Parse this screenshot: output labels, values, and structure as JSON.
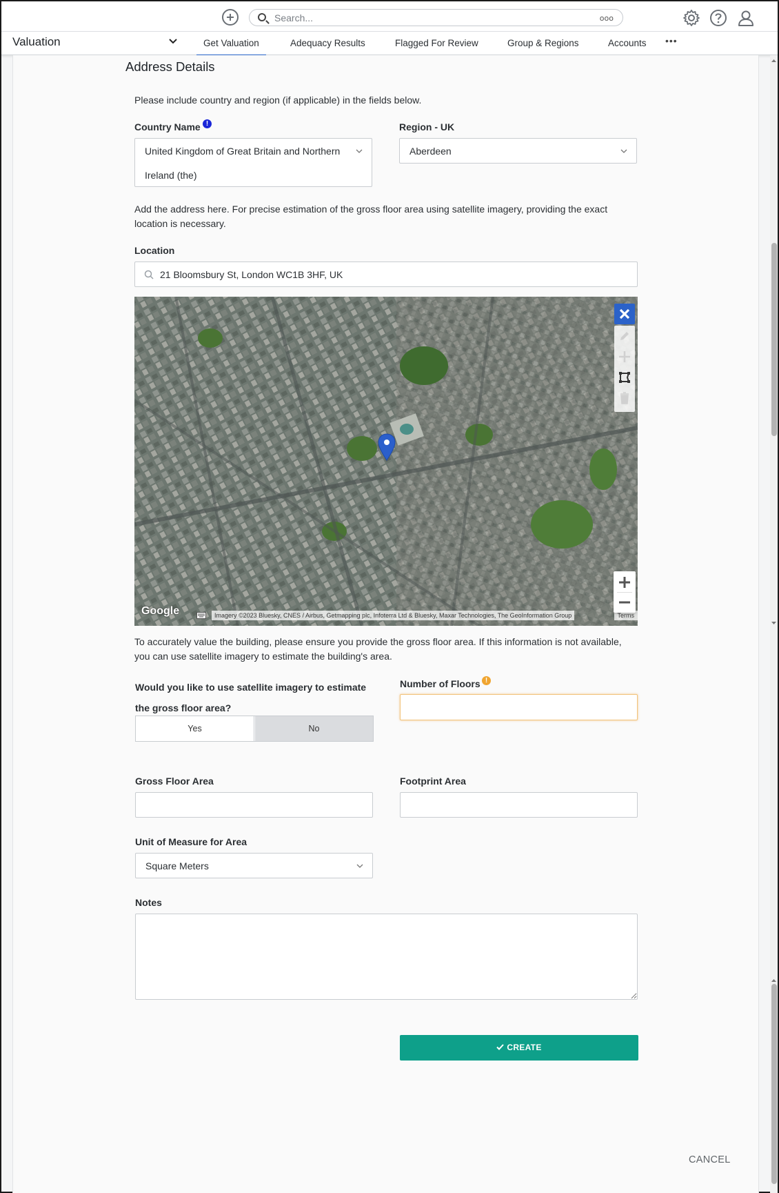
{
  "topbar": {
    "search_placeholder": "Search...",
    "search_options": "ooo",
    "icons": [
      "add-icon",
      "search-icon",
      "gear-icon",
      "help-icon",
      "user-icon"
    ]
  },
  "nav": {
    "app_name": "Valuation",
    "tabs": [
      {
        "label": "Get Valuation",
        "active": true
      },
      {
        "label": "Adequacy Results"
      },
      {
        "label": "Flagged For Review"
      },
      {
        "label": "Group & Regions"
      },
      {
        "label": "Accounts"
      }
    ],
    "more": "•••"
  },
  "form": {
    "section_title": "Address Details",
    "country_hint": "Please include country and region (if applicable) in the fields below.",
    "country_label": "Country Name",
    "country_value_line1": "United Kingdom of Great Britain and Northern",
    "country_value_line2": "Ireland (the)",
    "region_label": "Region - UK",
    "region_value": "Aberdeen",
    "address_hint": "Add the address here. For precise estimation of the gross floor area using satellite imagery, providing the exact location is necessary.",
    "location_label": "Location",
    "location_value": "21 Bloomsbury St, London WC1B 3HF, UK",
    "map": {
      "logo": "Google",
      "attribution": "Imagery ©2023 Bluesky, CNES / Airbus, Getmapping plc, Infoterra Ltd & Bluesky, Maxar Technologies, The GeoInformation Group",
      "terms": "Terms"
    },
    "gfa_hint": "To accurately value the building, please ensure you provide the gross floor area. If this information is not available, you can use satellite imagery to estimate the building's area.",
    "satellite_question": "Would you like to use satellite imagery to estimate the gross floor area?",
    "satellite_yes": "Yes",
    "satellite_no": "No",
    "satellite_selected": "No",
    "floors_label": "Number of Floors",
    "floors_value": "",
    "gfa_label": "Gross Floor Area",
    "gfa_value": "",
    "footprint_label": "Footprint Area",
    "footprint_value": "",
    "unit_label": "Unit of Measure for Area",
    "unit_value": "Square Meters",
    "notes_label": "Notes",
    "notes_value": "",
    "create_label": "CREATE",
    "cancel_label": "CANCEL"
  },
  "colors": {
    "accent_tab": "#2462c8",
    "create_button": "#0ea08a",
    "info_blue": "#1a26d8",
    "warning_orange": "#f0a530",
    "floors_border": "#f2c27a"
  }
}
